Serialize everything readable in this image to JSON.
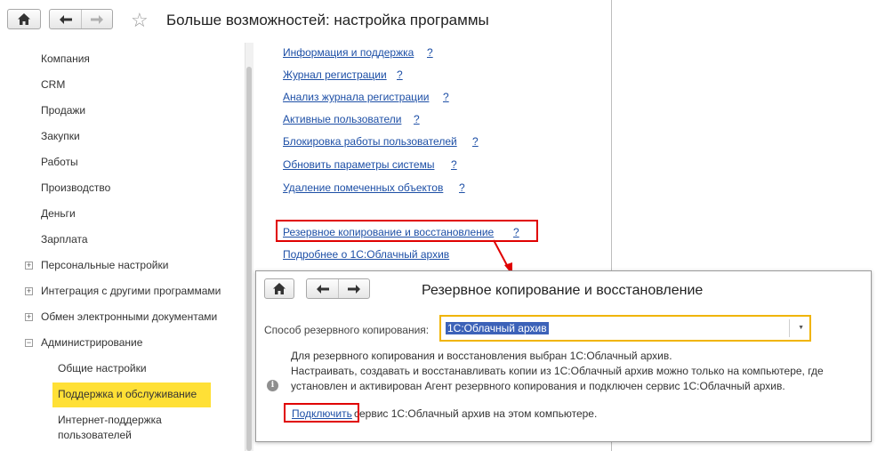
{
  "window": {
    "title": "Больше возможностей: настройка программы"
  },
  "sidebar": {
    "items": [
      {
        "label": "Компания"
      },
      {
        "label": "CRM"
      },
      {
        "label": "Продажи"
      },
      {
        "label": "Закупки"
      },
      {
        "label": "Работы"
      },
      {
        "label": "Производство"
      },
      {
        "label": "Деньги"
      },
      {
        "label": "Зарплата"
      },
      {
        "label": "Персональные настройки",
        "toggle": "+"
      },
      {
        "label": "Интеграция с другими программами",
        "toggle": "+"
      },
      {
        "label": "Обмен электронными документами",
        "toggle": "+"
      },
      {
        "label": "Администрирование",
        "toggle": "−"
      }
    ],
    "subitems": [
      {
        "label": "Общие настройки"
      },
      {
        "label": "Поддержка и обслуживание",
        "selected": true
      },
      {
        "label": "Интернет-поддержка",
        "label2": "пользователей"
      }
    ]
  },
  "links": [
    {
      "label": "Информация и поддержка",
      "help": "?"
    },
    {
      "label": "Журнал регистрации",
      "help": "?"
    },
    {
      "label": "Анализ журнала регистрации",
      "help": "?"
    },
    {
      "label": "Активные пользователи",
      "help": "?"
    },
    {
      "label": "Блокировка работы пользователей",
      "help": "?"
    },
    {
      "label": "Обновить параметры системы",
      "help": "?"
    },
    {
      "label": "Удаление помеченных объектов",
      "help": "?"
    },
    {
      "label": "Резервное копирование и восстановление",
      "help": "?"
    },
    {
      "label": "Подробнее о 1С:Облачный архив"
    }
  ],
  "popup": {
    "title": "Резервное копирование и восстановление",
    "backup_label": "Способ резервного копирования:",
    "backup_value": "1С:Облачный архив",
    "info_line1": "Для резервного копирования и восстановления выбран 1С:Облачный архив.",
    "info_line2": "Настраивать, создавать и восстанавливать копии из 1С:Облачный архив можно только на компьютере, где",
    "info_line3": "установлен и активирован Агент резервного копирования и подключен сервис 1С:Облачный архив.",
    "connect_link": "Подключить",
    "connect_text": "сервис 1С:Облачный архив на этом компьютере."
  },
  "colors": {
    "link": "#1d4fa6",
    "highlight": "#ffe036",
    "red_frame": "#e00000",
    "select_border": "#f0b400",
    "selected_value_bg": "#3c62b8"
  }
}
